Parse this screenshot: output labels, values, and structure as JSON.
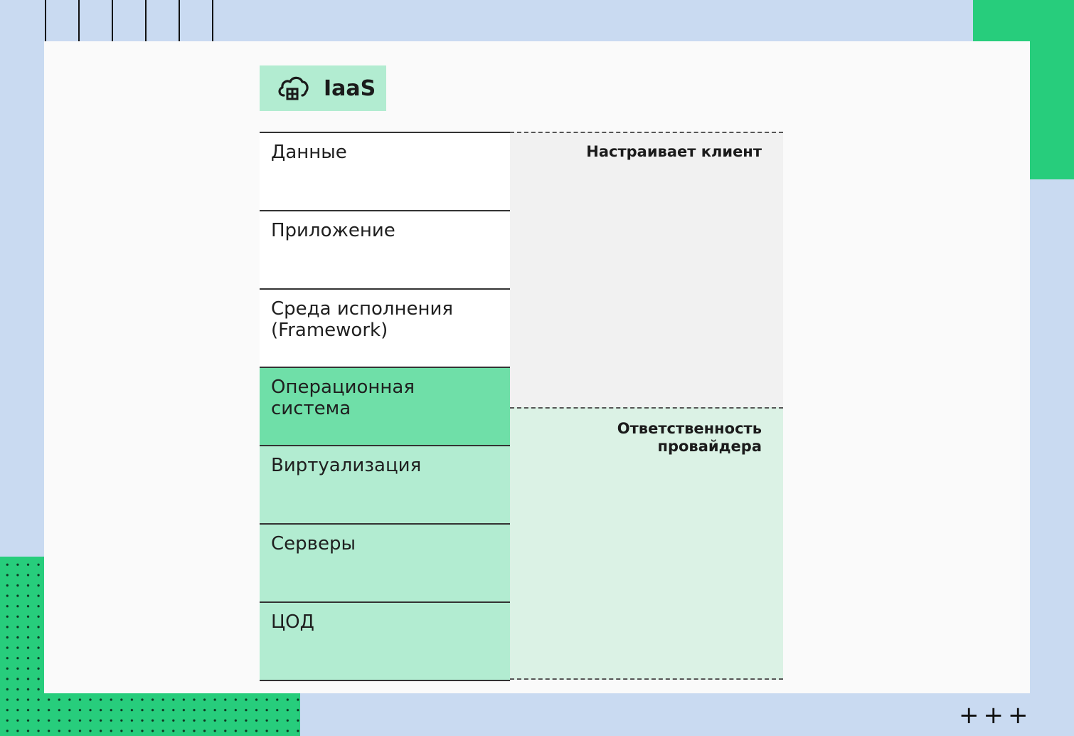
{
  "badge": {
    "label": "IaaS",
    "icon": "cloud-server-icon"
  },
  "layers": [
    {
      "label": "Данные",
      "owner": "client"
    },
    {
      "label": "Приложение",
      "owner": "client"
    },
    {
      "label": "Среда исполнения\n(Framework)",
      "owner": "client"
    },
    {
      "label": "Операционная\nсистема",
      "owner": "client",
      "highlight": true
    },
    {
      "label": "Виртуализация",
      "owner": "provider"
    },
    {
      "label": "Серверы",
      "owner": "provider"
    },
    {
      "label": "ЦОД",
      "owner": "provider"
    }
  ],
  "zones": {
    "client": "Настраивает клиент",
    "provider": "Ответственность\nпровайдера"
  },
  "colors": {
    "background": "#c9daf1",
    "accent_green": "#27cd7c",
    "layer_highlight": "#6fdfa8",
    "layer_provider": "#b2ecd1",
    "zone_client": "#f1f1f1",
    "zone_provider": "#dbf2e5"
  },
  "decor": {
    "plus_marks": "+++"
  }
}
